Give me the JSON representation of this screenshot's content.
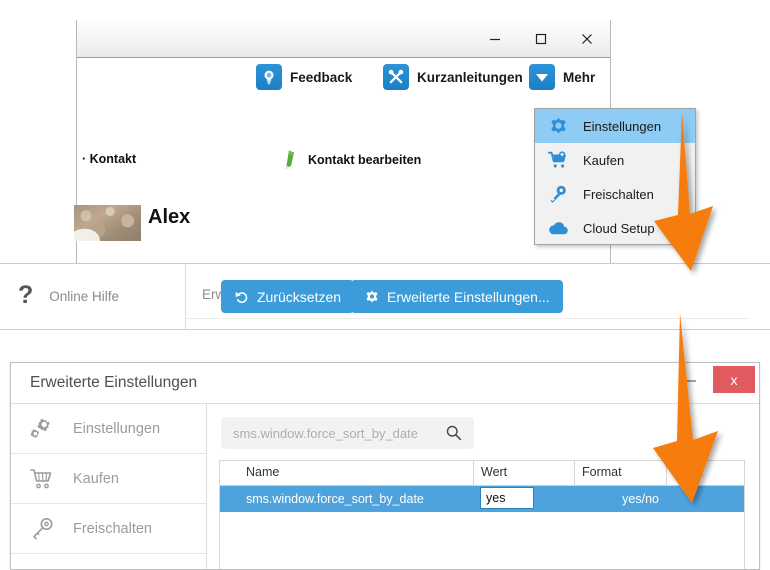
{
  "top_window": {
    "title_bar": {
      "minimize": "minimize",
      "maximize": "maximize",
      "close": "close"
    },
    "toolbar": [
      {
        "label": "Feedback",
        "icon": "lightbulb-icon"
      },
      {
        "label": "Kurzanleitungen",
        "icon": "tools-icon"
      },
      {
        "label": "Mehr",
        "icon": "chevron-down-icon"
      }
    ],
    "contact_label": "· Kontakt",
    "contact_edit_label": "Kontakt bearbeiten",
    "contact_edit_icon": "pencil-icon",
    "contact_name": "Alex"
  },
  "dropdown": {
    "items": [
      {
        "label": "Einstellungen",
        "icon": "gear-icon",
        "selected": true
      },
      {
        "label": "Kaufen",
        "icon": "shopping-cart-icon",
        "selected": false
      },
      {
        "label": "Freischalten",
        "icon": "key-icon",
        "selected": false
      },
      {
        "label": "Cloud Setup",
        "icon": "cloud-icon",
        "selected": false
      }
    ]
  },
  "mid_bar": {
    "help_label": "Online Hilfe",
    "help_icon": "question-mark-icon",
    "section_caption": "Erweiterte Einstellungen",
    "reset_button": "Zurücksetzen",
    "reset_icon": "undo-arrow-icon",
    "advanced_button": "Erweiterte Einstellungen...",
    "advanced_icon": "gear-icon"
  },
  "advanced_window": {
    "title": "Erweiterte Einstellungen",
    "minimize": "–",
    "close": "x",
    "sidebar": [
      {
        "label": "Einstellungen",
        "icon": "gears-icon"
      },
      {
        "label": "Kaufen",
        "icon": "shopping-cart-icon"
      },
      {
        "label": "Freischalten",
        "icon": "key-icon"
      }
    ],
    "search": {
      "value": "sms.window.force_sort_by_date",
      "placeholder": "sms.window.force_sort_by_date",
      "icon": "search-icon"
    },
    "grid": {
      "columns": [
        "Name",
        "Wert",
        "Format",
        "Berei"
      ],
      "rows": [
        {
          "name": "sms.window.force_sort_by_date",
          "wert": "yes",
          "format": "yes/no",
          "bereich": ""
        }
      ]
    }
  },
  "annotations": {
    "arrow_color": "#f57c11",
    "arrows": [
      {
        "name": "arrow-menu-to-advanced-button"
      },
      {
        "name": "arrow-advanced-button-to-grid-row"
      }
    ]
  },
  "colors": {
    "accent_blue": "#3b9cd9",
    "icon_blue": "#1c7fc4",
    "selection_blue": "#8ecbf5",
    "row_blue": "#4fa3dd",
    "close_red": "#e05a60",
    "orange": "#f57c11"
  }
}
